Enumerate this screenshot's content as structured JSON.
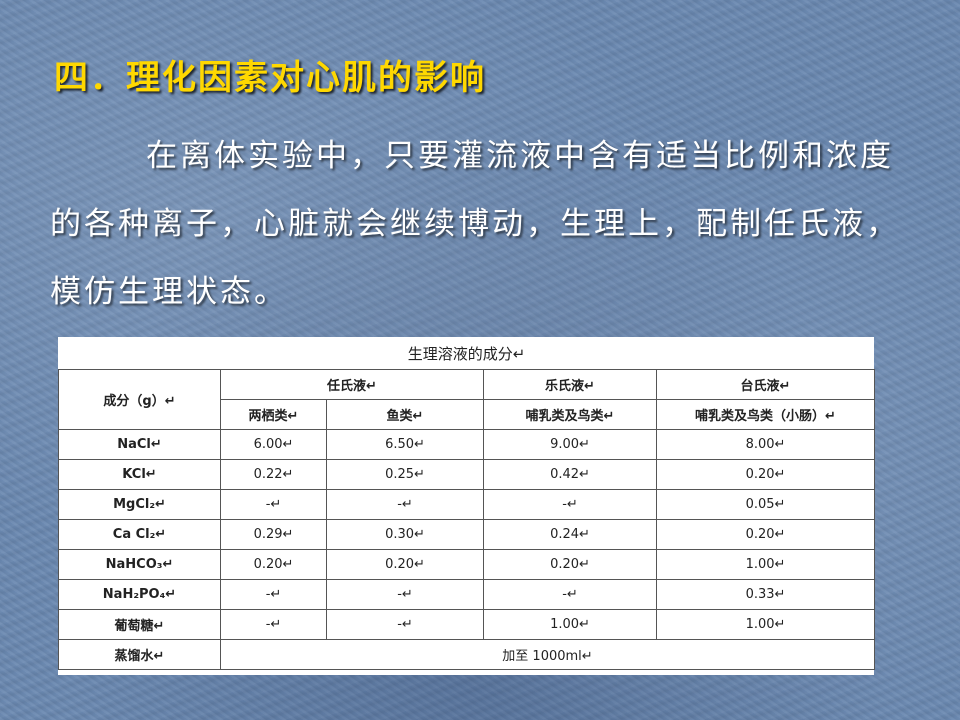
{
  "slide": {
    "title": "四．理化因素对心肌的影响",
    "paragraph": "在离体实验中，只要灌流液中含有适当比例和浓度的各种离子，心脏就会继续博动，生理上，配制任氏液，模仿生理状态。"
  },
  "table": {
    "caption": "生理溶液的成分↵",
    "corner_label": "成分（g）↵",
    "groups": [
      "任氏液↵",
      "乐氏液↵",
      "台氏液↵"
    ],
    "subheaders": [
      "两栖类↵",
      "鱼类↵",
      "哺乳类及鸟类↵",
      "哺乳类及鸟类（小肠）↵"
    ],
    "rows": [
      {
        "name": "NaCl↵",
        "values": [
          "6.00↵",
          "6.50↵",
          "9.00↵",
          "8.00↵"
        ]
      },
      {
        "name": "KCl↵",
        "values": [
          "0.22↵",
          "0.25↵",
          "0.42↵",
          "0.20↵"
        ]
      },
      {
        "name": "MgCl₂↵",
        "values": [
          "-↵",
          "-↵",
          "-↵",
          "0.05↵"
        ]
      },
      {
        "name": "Ca Cl₂↵",
        "values": [
          "0.29↵",
          "0.30↵",
          "0.24↵",
          "0.20↵"
        ]
      },
      {
        "name": "NaHCO₃↵",
        "values": [
          "0.20↵",
          "0.20↵",
          "0.20↵",
          "1.00↵"
        ]
      },
      {
        "name": "NaH₂PO₄↵",
        "values": [
          "-↵",
          "-↵",
          "-↵",
          "0.33↵"
        ]
      },
      {
        "name": "葡萄糖↵",
        "values": [
          "-↵",
          "-↵",
          "1.00↵",
          "1.00↵"
        ]
      }
    ],
    "last_row": {
      "name": "蒸馏水↵",
      "value": "加至 1000ml↵"
    }
  }
}
